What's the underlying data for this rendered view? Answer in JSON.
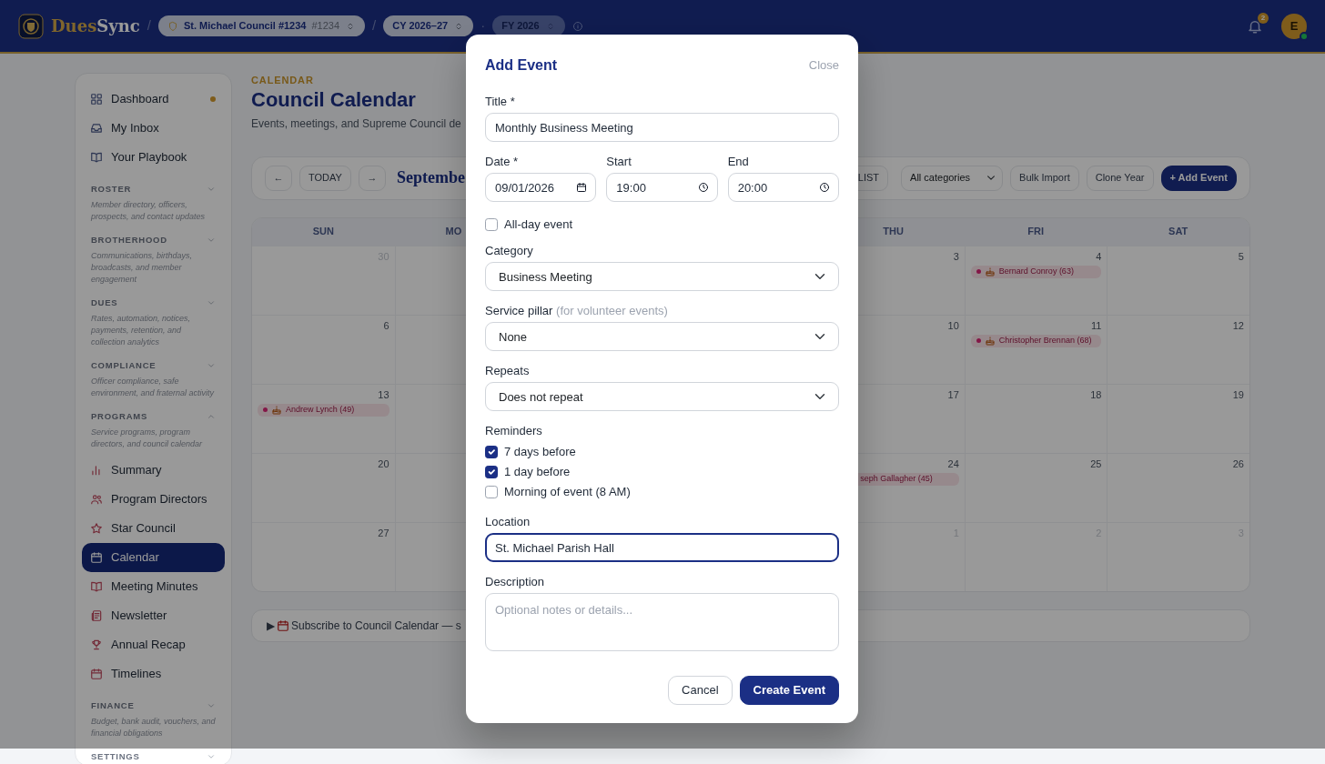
{
  "navbar": {
    "brand_parts": [
      "Dues",
      "Sync"
    ],
    "contexts": [
      {
        "kind": "council",
        "separator": "/",
        "text": "St. Michael Council #1234",
        "suffix": "#1234",
        "disabled": false
      },
      {
        "kind": "year",
        "separator": "/",
        "text": "CY 2026–27",
        "disabled": false
      },
      {
        "kind": "year",
        "separator": "·",
        "text": "FY 2026",
        "disabled": true
      }
    ],
    "notifications": {
      "count": "2"
    },
    "avatar": {
      "initial": "E",
      "online": true
    }
  },
  "sidebar": {
    "items": [
      {
        "label": "Dashboard",
        "selected": false,
        "notification": true
      },
      {
        "label": "My Inbox",
        "selected": false,
        "notification": false
      },
      {
        "label": "Your Playbook",
        "selected": false,
        "notification": false
      }
    ],
    "sections": [
      {
        "title": "ROSTER",
        "description": "Member directory, officers, prospects, and contact updates",
        "expanded": false
      },
      {
        "title": "BROTHERHOOD",
        "description": "Communications, birthdays, broadcasts, and member engagement",
        "expanded": false
      },
      {
        "title": "DUES",
        "description": "Rates, automation, notices, payments, retention, and collection analytics",
        "expanded": false
      },
      {
        "title": "COMPLIANCE",
        "description": "Officer compliance, safe environment, and fraternal activity",
        "expanded": false
      },
      {
        "title": "PROGRAMS",
        "description": "Service programs, program directors, and council calendar",
        "expanded": true,
        "items": [
          {
            "label": "Summary",
            "selected": false
          },
          {
            "label": "Program Directors",
            "selected": false
          },
          {
            "label": "Star Council",
            "selected": false
          },
          {
            "label": "Calendar",
            "selected": true
          },
          {
            "label": "Meeting Minutes",
            "selected": false
          },
          {
            "label": "Newsletter",
            "selected": false
          },
          {
            "label": "Annual Recap",
            "selected": false
          },
          {
            "label": "Timelines",
            "selected": false
          }
        ]
      },
      {
        "title": "FINANCE",
        "description": "Budget, bank audit, vouchers, and financial obligations",
        "expanded": false
      },
      {
        "title": "SETTINGS",
        "expanded": false
      }
    ]
  },
  "header": {
    "eyebrow": "CALENDAR",
    "title": "Council Calendar",
    "description": "Events, meetings, and Supreme Council de"
  },
  "toolbar": {
    "prev": "←",
    "today": "TODAY",
    "next": "→",
    "month_title": "Septembe",
    "views": [
      {
        "label": "LIST",
        "selected": false
      }
    ],
    "category_filter": "All categories",
    "buttons": [
      {
        "label": "Bulk Import",
        "kind": "outline"
      },
      {
        "label": "Clone Year",
        "kind": "outline"
      },
      {
        "label": "+ Add Event",
        "kind": "primary"
      }
    ]
  },
  "calendar": {
    "columns": [
      {
        "label": "SUN"
      },
      {
        "label": "MO"
      },
      {},
      {},
      {
        "label": "THU"
      },
      {
        "label": "FRI"
      },
      {
        "label": "SAT"
      }
    ],
    "weeks": [
      {
        "cells": [
          {
            "day": "30",
            "muted": true
          },
          {},
          {},
          {},
          {
            "day": "3",
            "muted": false
          },
          {
            "day": "4",
            "muted": false,
            "events": [
              {
                "kind": "birthday",
                "text": "Bernard Conroy (63)"
              }
            ]
          },
          {
            "day": "5",
            "muted": false
          }
        ]
      },
      {
        "cells": [
          {
            "day": "6",
            "muted": false
          },
          {},
          {},
          {},
          {
            "day": "10",
            "muted": false
          },
          {
            "day": "11",
            "muted": false,
            "events": [
              {
                "kind": "birthday",
                "text": "Christopher Brennan (68)"
              }
            ]
          },
          {
            "day": "12",
            "muted": false
          }
        ]
      },
      {
        "cells": [
          {
            "day": "13",
            "muted": false,
            "events": [
              {
                "kind": "birthday",
                "text": "Andrew Lynch (49)"
              }
            ]
          },
          {},
          {},
          {},
          {
            "day": "17",
            "muted": false
          },
          {
            "day": "18",
            "muted": false
          },
          {
            "day": "19",
            "muted": false
          }
        ]
      },
      {
        "cells": [
          {
            "day": "20",
            "muted": false
          },
          {},
          {},
          {},
          {
            "day": "24",
            "muted": false,
            "events": [
              {
                "kind": "partial",
                "text": "seph Gallagher (45)"
              }
            ]
          },
          {
            "day": "25",
            "muted": false
          },
          {
            "day": "26",
            "muted": false
          }
        ]
      },
      {
        "cells": [
          {
            "day": "27",
            "muted": false
          },
          {},
          {},
          {},
          {
            "day": "1",
            "muted": true
          },
          {
            "day": "2",
            "muted": true
          },
          {
            "day": "3",
            "muted": true
          }
        ]
      }
    ]
  },
  "subscribe": {
    "toggle": "▶",
    "text": "Subscribe to Council Calendar — s"
  },
  "modal": {
    "title": "Add Event",
    "close": "Close",
    "fields": [
      {
        "kind": "text",
        "label": "Title *",
        "value": "Monthly Business Meeting",
        "focused": false
      },
      {
        "kind": "datetime",
        "parts": [
          {
            "kind": "date",
            "label": "Date *",
            "value": "09/01/2026"
          },
          {
            "kind": "time",
            "label": "Start",
            "value": "19:00"
          },
          {
            "kind": "time",
            "label": "End",
            "value": "20:00"
          }
        ]
      },
      {
        "kind": "checkbox",
        "label": "All-day event",
        "checked": false
      },
      {
        "kind": "select",
        "label": "Category",
        "value": "Business Meeting"
      },
      {
        "kind": "select",
        "label": "Service pillar",
        "hint": "(for volunteer events)",
        "value": "None"
      },
      {
        "kind": "select",
        "label": "Repeats",
        "value": "Does not repeat"
      },
      {
        "kind": "checklist",
        "label": "Reminders",
        "options": [
          {
            "label": "7 days before",
            "checked": true
          },
          {
            "label": "1 day before",
            "checked": true
          },
          {
            "label": "Morning of event (8 AM)",
            "checked": false
          }
        ]
      },
      {
        "kind": "text",
        "label": "Location",
        "value": "St. Michael Parish Hall",
        "focused": true
      },
      {
        "kind": "textarea",
        "label": "Description",
        "placeholder": "Optional notes or details..."
      }
    ],
    "actions": [
      {
        "label": "Cancel",
        "kind": "secondary"
      },
      {
        "label": "Create Event",
        "kind": "primary"
      }
    ]
  }
}
